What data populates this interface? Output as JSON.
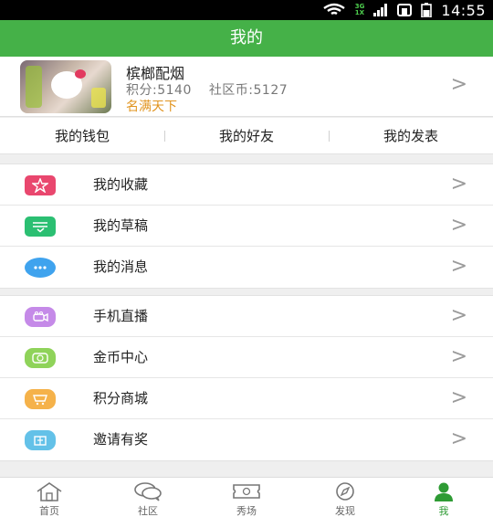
{
  "status_bar": {
    "network": "3G\n1X",
    "time": "14:55"
  },
  "header": {
    "title": "我的"
  },
  "profile": {
    "name": "槟榔配烟",
    "points_label": "积分:5140",
    "coins_label": "社区币:5127",
    "rank": "名满天下"
  },
  "tabs": [
    {
      "label": "我的钱包"
    },
    {
      "label": "我的好友"
    },
    {
      "label": "我的发表"
    }
  ],
  "group1": [
    {
      "label": "我的收藏",
      "icon": "star-icon",
      "color": "#e9476e"
    },
    {
      "label": "我的草稿",
      "icon": "draft-icon",
      "color": "#2bbf72"
    },
    {
      "label": "我的消息",
      "icon": "chat-bubble-icon",
      "color": "#3fa3ee"
    }
  ],
  "group2": [
    {
      "label": "手机直播",
      "icon": "video-camera-icon",
      "color": "#c58ae8"
    },
    {
      "label": "金币中心",
      "icon": "coin-icon",
      "color": "#8fd35a"
    },
    {
      "label": "积分商城",
      "icon": "cart-icon",
      "color": "#f5b24a"
    },
    {
      "label": "邀请有奖",
      "icon": "gift-icon",
      "color": "#63c1e8"
    }
  ],
  "bottom_nav": [
    {
      "label": "首页",
      "icon": "home-icon"
    },
    {
      "label": "社区",
      "icon": "community-icon"
    },
    {
      "label": "秀场",
      "icon": "ticket-icon"
    },
    {
      "label": "发现",
      "icon": "compass-icon"
    },
    {
      "label": "我",
      "icon": "person-icon",
      "active": true
    }
  ],
  "chevron": ">",
  "colors": {
    "accent": "#45b148",
    "rank": "#e1941f",
    "active_nav": "#2e9b34"
  }
}
